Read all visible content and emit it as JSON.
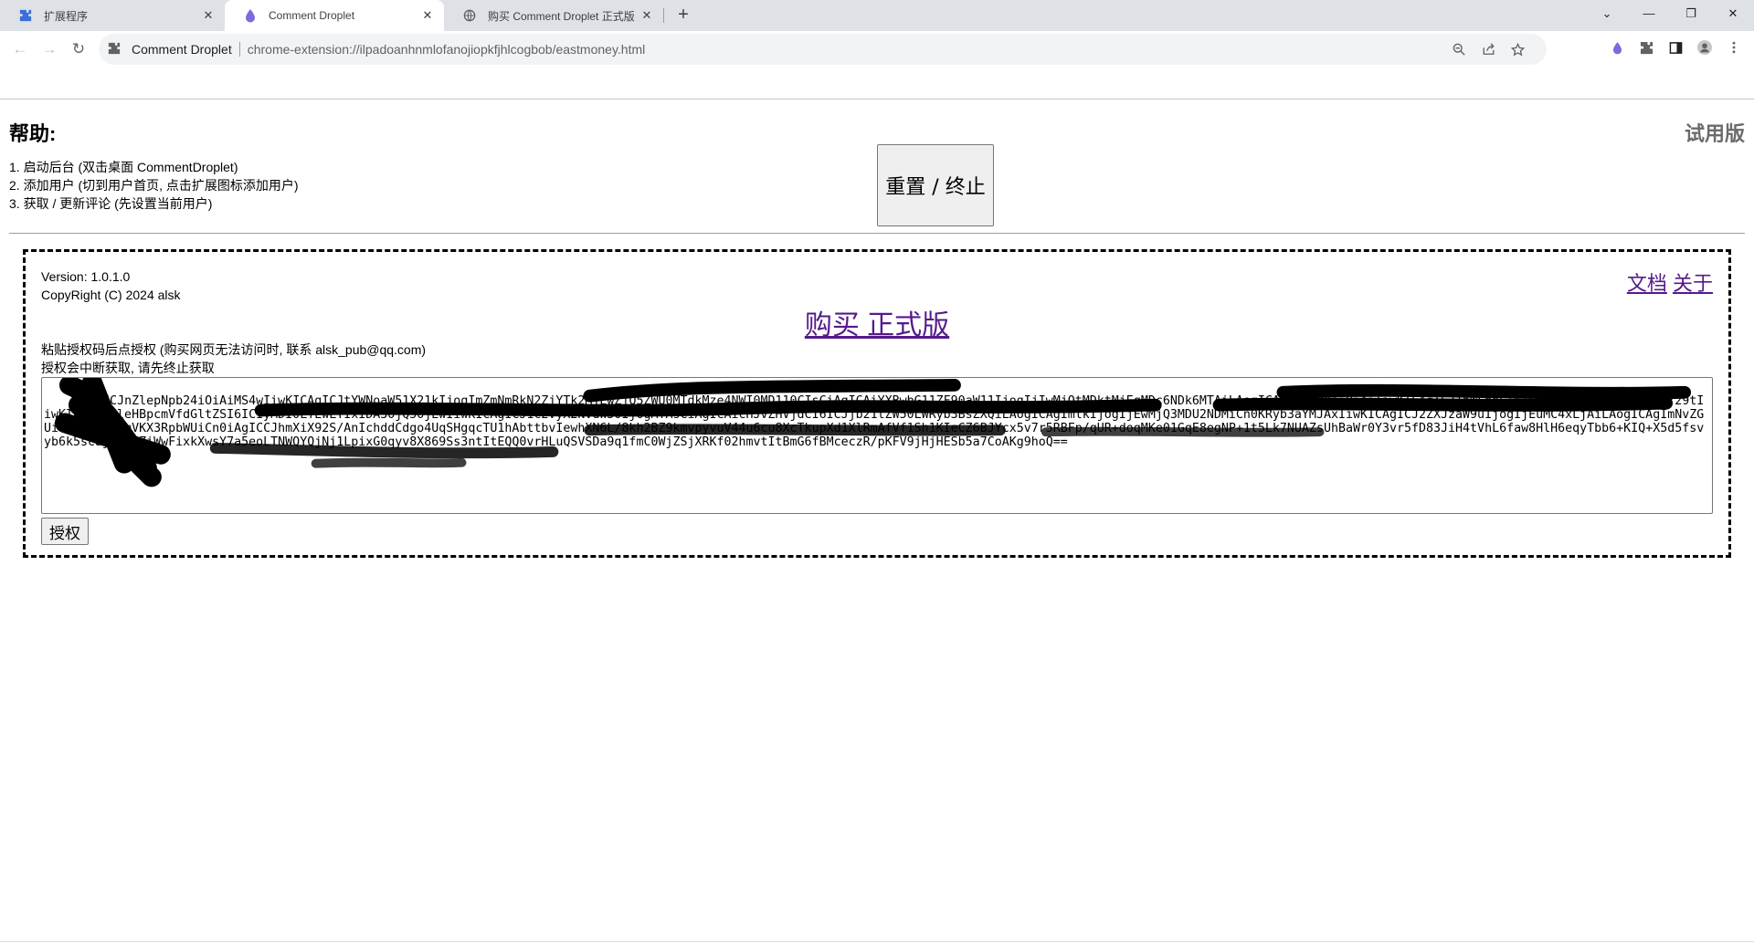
{
  "browser": {
    "tabs": [
      {
        "title": "扩展程序",
        "icon": "puzzle-icon",
        "active": false
      },
      {
        "title": "Comment Droplet",
        "icon": "droplet-icon",
        "active": true
      },
      {
        "title": "购买 Comment Droplet 正式版",
        "icon": "globe-icon",
        "active": false
      }
    ],
    "new_tab_label": "+",
    "omnibox": {
      "site_name": "Comment Droplet",
      "url": "chrome-extension://ilpadoanhnmlofanojiopkfjhlcogbob/eastmoney.html"
    },
    "colors": {
      "tabstrip": "#dee1e6",
      "omnibox": "#f1f3f4",
      "accent": "#7b6cd9"
    }
  },
  "page": {
    "help_title": "帮助:",
    "trial_label": "试用版",
    "help_items": [
      "1. 启动后台 (双击桌面 CommentDroplet)",
      "2. 添加用户 (切到用户首页, 点击扩展图标添加用户)",
      "3. 获取 / 更新评论 (先设置当前用户)"
    ],
    "reset_button": "重置 / 终止",
    "version": "Version: 1.0.1.0",
    "copyright": "CopyRight (C) 2024 alsk",
    "links": {
      "docs": "文档",
      "about": "关于"
    },
    "buy_link": "购买 正式版",
    "hint_line1": "粘贴授权码后点授权 (购买网页无法访问时, 联系 alsk_pub@qq.com)",
    "hint_line2": "授权会中断获取, 请先终止获取",
    "license_code": "ewogICJnZlepNpb24iOiAiMS4wIiwKICAgICJtYWNoaW51X21kIjogImZmNmRkN2ZjYTk2MjEwZjQ5ZWU0MTdkMze4NWI0MD110CIsCiAgICAiYXBwbG11ZF90aW11IjogIjIwMjQtMDktMjEgMDc6NDk6MTAiLAogICAgInVzZXIiOiAiIiwKICAgICJ1bWFpbCI6ICJfc2FsazJpdWJAcXEuY29tIiwKICAgICJleHBpcmVfdGltZSI6ICIyMDI0LTEwLTIxIDA3OjQ5OjEwIiwKICAgICJ1c2VyX2NvdW50IjogMTAsCiAgICAicHJvZHVjdCI6ICJjb21tZW50LWRyb3BsZXQiLAogICAgImlkIjogIjEwMjQ3MDU2NDMiCn0KRyb3aYMJAxIiwKICAgICJ2ZXJzaW9uIjogIjEuMC4xLjAiLAogICAgImNvZGUiOiAiRXhQemVKX3RpbWUiCn0iAgICCJhmXiX92S/AnIchddCdgo4UqSHgqcTU1hAbttbvIewhXN6L/8kh2BZ9kmvpyvuV44u6cu8XcTkupXd1XlRmAfVf1Sh1KIeCZ6BJYcx5v7r5RBFp/qUR+doqMKe01GqE8egNP+1t5Lk7NUAZsUhBaWr0Y3vr5fD83JiH4tVhL6faw8HlH6eqyTbb6+KIQ+X5d5fsvyb6k5scajsRUtZiWwFixkXwsY7a5eoLTNWQYQjNj1LpixG0qyv8X869Ss3ntItEQQ0vrHLuQSVSDa9q1fmC0WjZSjXRKf02hmvtItBmG6fBMceczR/pKFV9jHjHESb5a7CoAKg9hoQ==",
    "auth_button": "授权"
  }
}
